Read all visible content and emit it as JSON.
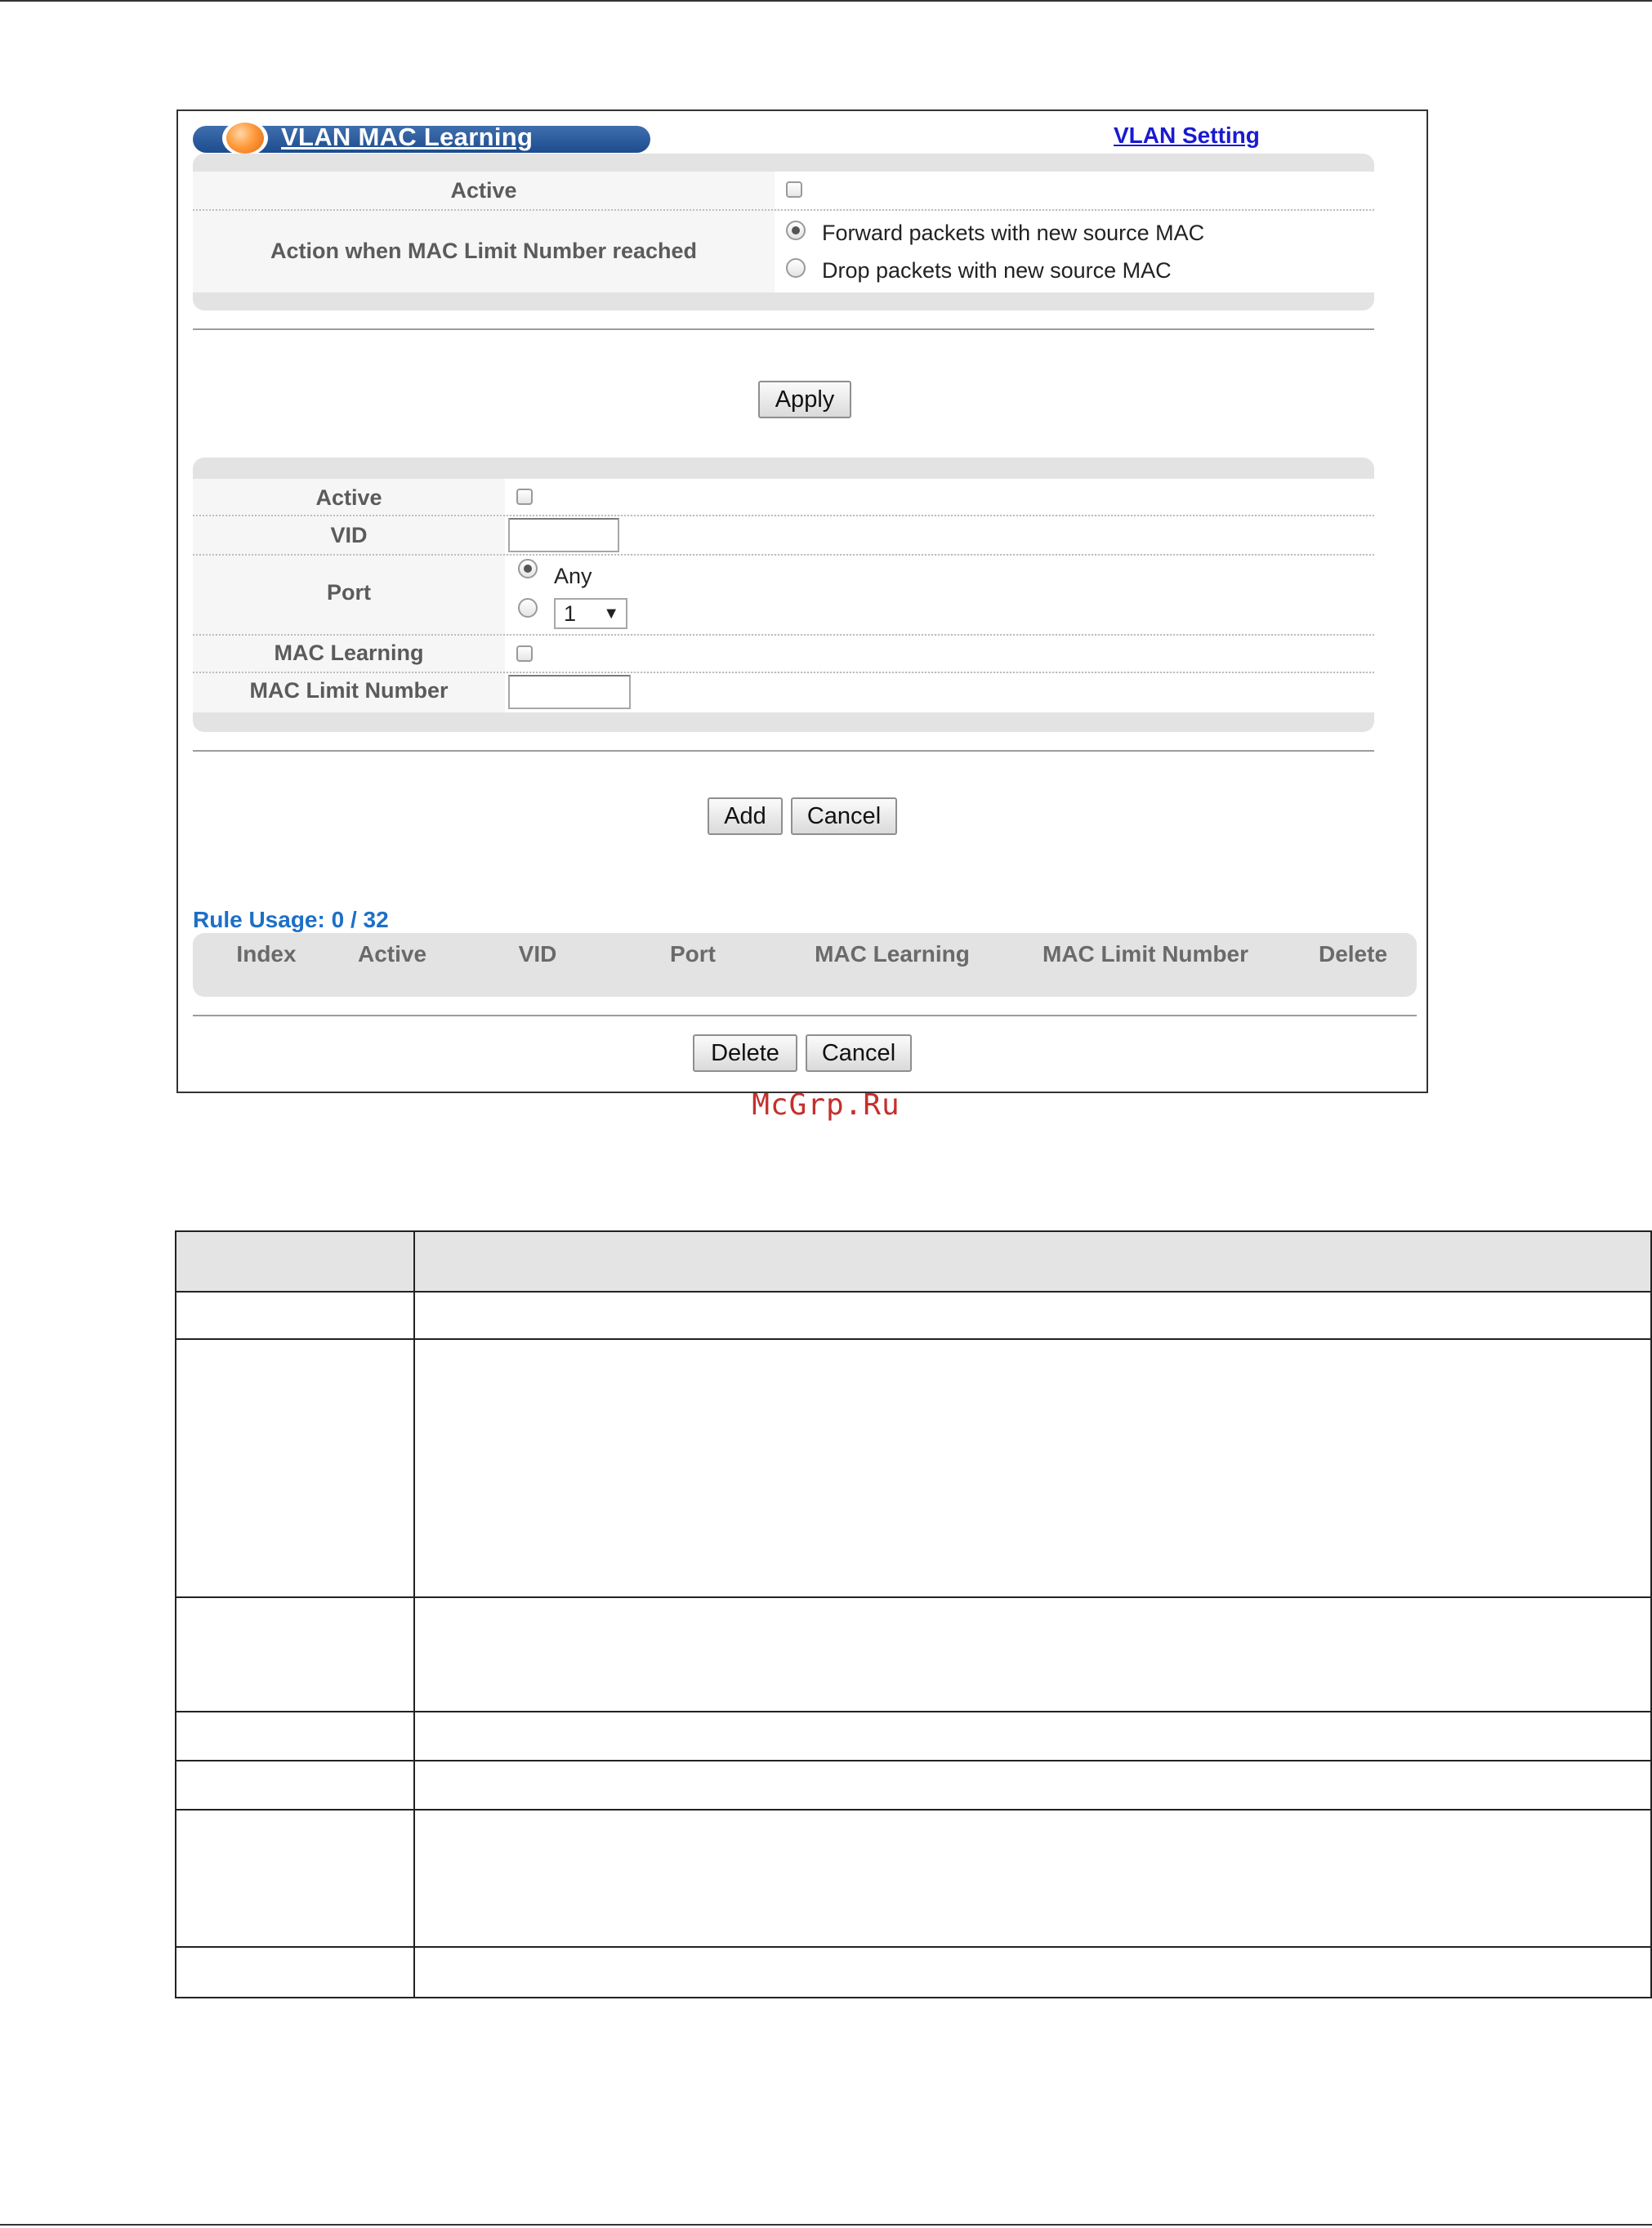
{
  "window": {
    "title": "VLAN MAC Learning",
    "link": "VLAN Setting"
  },
  "global": {
    "active_label": "Active",
    "active_checked": false,
    "action_label": "Action when MAC Limit Number reached",
    "action_options": [
      {
        "label": "Forward packets with new source MAC",
        "selected": true
      },
      {
        "label": "Drop packets with new source MAC",
        "selected": false
      }
    ],
    "apply_label": "Apply"
  },
  "rule_form": {
    "active_label": "Active",
    "active_checked": false,
    "vid_label": "VID",
    "vid_value": "",
    "port_label": "Port",
    "port_any_label": "Any",
    "port_any_selected": true,
    "port_select_value": "1",
    "mac_learning_label": "MAC Learning",
    "mac_learning_checked": false,
    "mac_limit_label": "MAC Limit Number",
    "mac_limit_value": "",
    "add_label": "Add",
    "cancel_label": "Cancel"
  },
  "rules": {
    "usage": "Rule Usage: 0 / 32",
    "columns": [
      "Index",
      "Active",
      "VID",
      "Port",
      "MAC Learning",
      "MAC Limit Number",
      "Delete"
    ],
    "rows": [],
    "delete_label": "Delete",
    "cancel_label": "Cancel"
  },
  "watermark": "McGrp.Ru",
  "icons": {
    "title_orb": "orange-orb-icon",
    "select_arrow": "chevron-down-icon"
  },
  "colors": {
    "title_bar": "#1d4c8f",
    "link": "#1a1ad0",
    "usage_text": "#1d6fc7",
    "watermark": "#c4302b",
    "panel": "#e3e3e3"
  }
}
